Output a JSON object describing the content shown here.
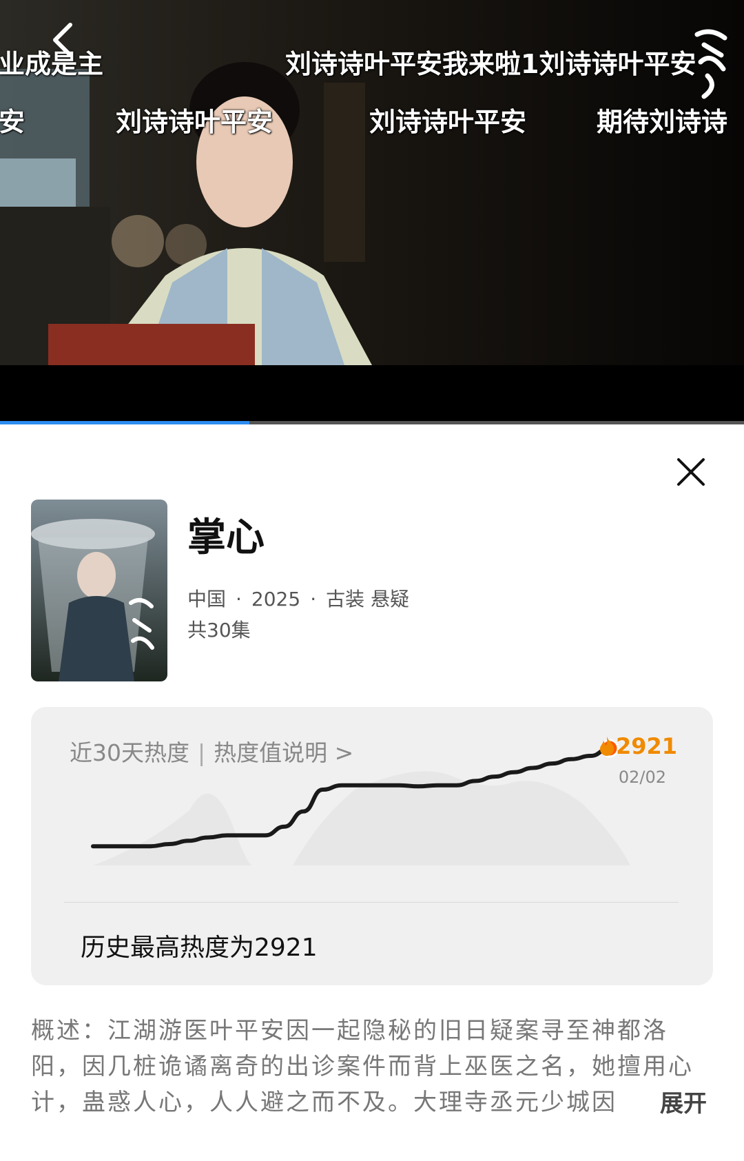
{
  "video": {
    "danmaku": [
      "业成是主",
      "刘诗诗叶平安我来啦1刘诗诗叶平安",
      "安",
      "刘诗诗叶平安",
      "刘诗诗叶平安",
      "期待刘诗诗"
    ],
    "progress_fraction": 0.335
  },
  "show": {
    "title": "掌心",
    "region": "中国",
    "year": "2025",
    "genres": "古装 悬疑",
    "episodes": "共30集"
  },
  "heat": {
    "header_label": "近30天热度",
    "separator": "|",
    "link_label": "热度值说明 >",
    "current_value": "2921",
    "current_date": "02/02",
    "peak_text": "历史最高热度为2921"
  },
  "summary": {
    "text": "概述：江湖游医叶平安因一起隐秘的旧日疑案寻至神都洛阳，因几桩诡谲离奇的出诊案件而背上巫医之名，她擅用心计，蛊惑人心，人人避之而不及。大理寺丞元少城因",
    "expand_label": "展开"
  },
  "colors": {
    "accent_blue": "#2d8cf0",
    "heat_orange": "#f08a00",
    "dot_orange": "#ff5a00"
  },
  "icons": {
    "back": "chevron-left-icon",
    "close": "close-icon",
    "fire": "fire-icon"
  },
  "chart_data": {
    "type": "line",
    "series": [
      {
        "values": [
          0.1,
          0.1,
          0.1,
          0.1,
          0.12,
          0.15,
          0.18,
          0.2,
          0.2,
          0.2,
          0.28,
          0.42,
          0.62,
          0.66,
          0.66,
          0.66,
          0.66,
          0.65,
          0.66,
          0.66,
          0.7,
          0.74,
          0.78,
          0.82,
          0.86,
          0.9,
          0.93,
          1.0
        ]
      }
    ],
    "last_point": {
      "label": "02/02",
      "value": 2921
    }
  }
}
